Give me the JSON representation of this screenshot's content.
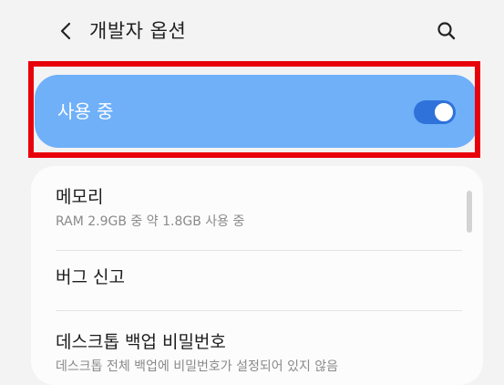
{
  "header": {
    "title": "개발자 옵션",
    "back_icon": "chevron-left-icon",
    "search_icon": "search-icon"
  },
  "master_switch": {
    "label": "사용 중",
    "state": "on",
    "accent_color": "#2f72d9",
    "card_color": "#6fb0f9"
  },
  "items": [
    {
      "title": "메모리",
      "subtitle": "RAM 2.9GB 중 약 1.8GB 사용 중"
    },
    {
      "title": "버그 신고"
    },
    {
      "title": "데스크톱 백업 비밀번호",
      "subtitle": "데스크톱 전체 백업에 비밀번호가 설정되어 있지 않음"
    }
  ]
}
